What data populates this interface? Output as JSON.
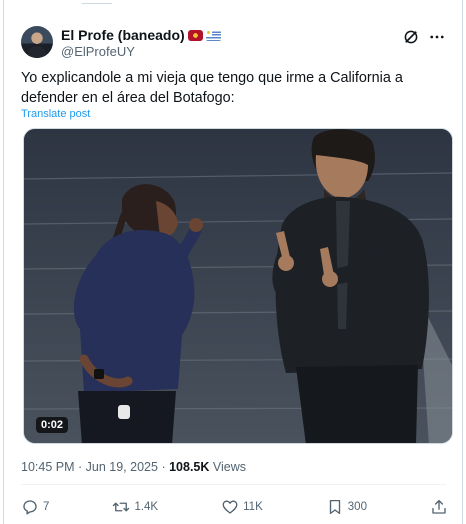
{
  "author": {
    "display_name": "El Profe (baneado)",
    "handle": "@ElProfeUY",
    "badges": [
      "club-crest-icon",
      "uruguay-flag-icon"
    ]
  },
  "tweet": {
    "text": "Yo explicandole a mi vieja que tengo que irme a California a defender en el área del Botafogo:",
    "translate_label": "Translate post"
  },
  "media": {
    "type": "video",
    "duration": "0:02"
  },
  "meta": {
    "time": "10:45 PM",
    "separator": "·",
    "date": "Jun 19, 2025",
    "views_count": "108.5K",
    "views_label": "Views"
  },
  "actions": {
    "replies": "7",
    "reposts": "1.4K",
    "likes": "11K",
    "bookmarks": "300"
  },
  "colors": {
    "text": "#0f1419",
    "secondary": "#536471",
    "link": "#1d9bf0",
    "border": "#cfd9de"
  }
}
